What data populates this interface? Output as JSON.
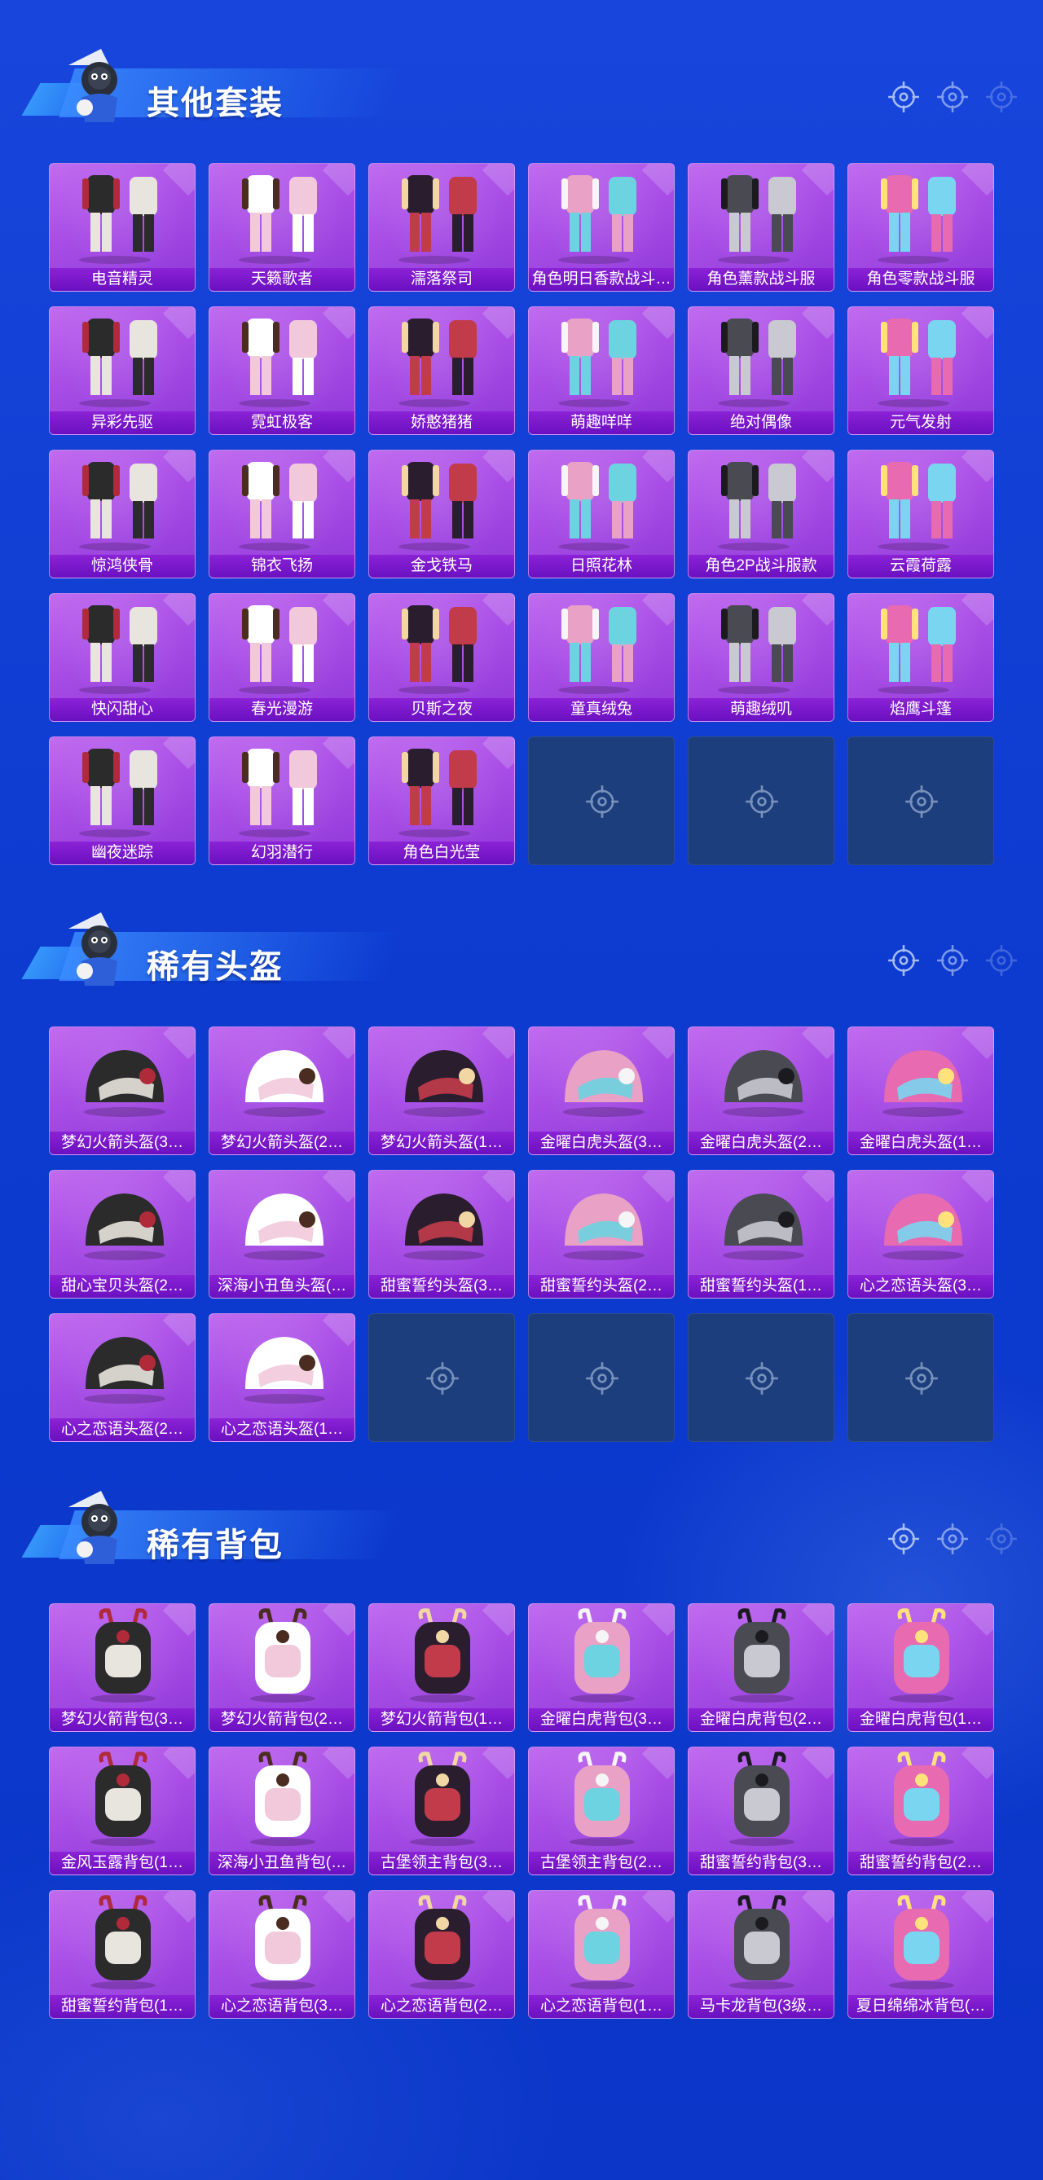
{
  "sections": [
    {
      "title": "其他套装",
      "category": "outfit",
      "items": [
        "电音精灵",
        "天籁歌者",
        "濡落祭司",
        "角色明日香款战斗…",
        "角色薰款战斗服",
        "角色零款战斗服",
        "异彩先驱",
        "霓虹极客",
        "娇憨猪猪",
        "萌趣咩咩",
        "绝对偶像",
        "元气发射",
        "惊鸿侠骨",
        "锦衣飞扬",
        "金戈铁马",
        "日照花林",
        "角色2P战斗服款",
        "云霞荷露",
        "快闪甜心",
        "春光漫游",
        "贝斯之夜",
        "童真绒兔",
        "萌趣绒叽",
        "焰鹰斗篷",
        "幽夜迷踪",
        "幻羽潜行",
        "角色白光莹"
      ],
      "empty_slots": 3
    },
    {
      "title": "稀有头盔",
      "category": "helmet",
      "items": [
        "梦幻火箭头盔(3…",
        "梦幻火箭头盔(2…",
        "梦幻火箭头盔(1…",
        "金曜白虎头盔(3…",
        "金曜白虎头盔(2…",
        "金曜白虎头盔(1…",
        "甜心宝贝头盔(2…",
        "深海小丑鱼头盔(…",
        "甜蜜誓约头盔(3…",
        "甜蜜誓约头盔(2…",
        "甜蜜誓约头盔(1…",
        "心之恋语头盔(3…",
        "心之恋语头盔(2…",
        "心之恋语头盔(1…"
      ],
      "empty_slots": 4
    },
    {
      "title": "稀有背包",
      "category": "backpack",
      "items": [
        "梦幻火箭背包(3…",
        "梦幻火箭背包(2…",
        "梦幻火箭背包(1…",
        "金曜白虎背包(3…",
        "金曜白虎背包(2…",
        "金曜白虎背包(1…",
        "金风玉露背包(1…",
        "深海小丑鱼背包(…",
        "古堡领主背包(3…",
        "古堡领主背包(2…",
        "甜蜜誓约背包(3…",
        "甜蜜誓约背包(2…",
        "甜蜜誓约背包(1…",
        "心之恋语背包(3…",
        "心之恋语背包(2…",
        "心之恋语背包(1…",
        "马卡龙背包(3级…",
        "夏日绵绵冰背包(…"
      ],
      "empty_slots": 0
    }
  ],
  "colors": {
    "background": "#0d3bd0",
    "tile_fill": "#a84de6",
    "label_bar": "#7416c8",
    "empty_tile": "#1d3e7c"
  },
  "icons": [
    "crosshair-icon",
    "mascot-icon"
  ]
}
